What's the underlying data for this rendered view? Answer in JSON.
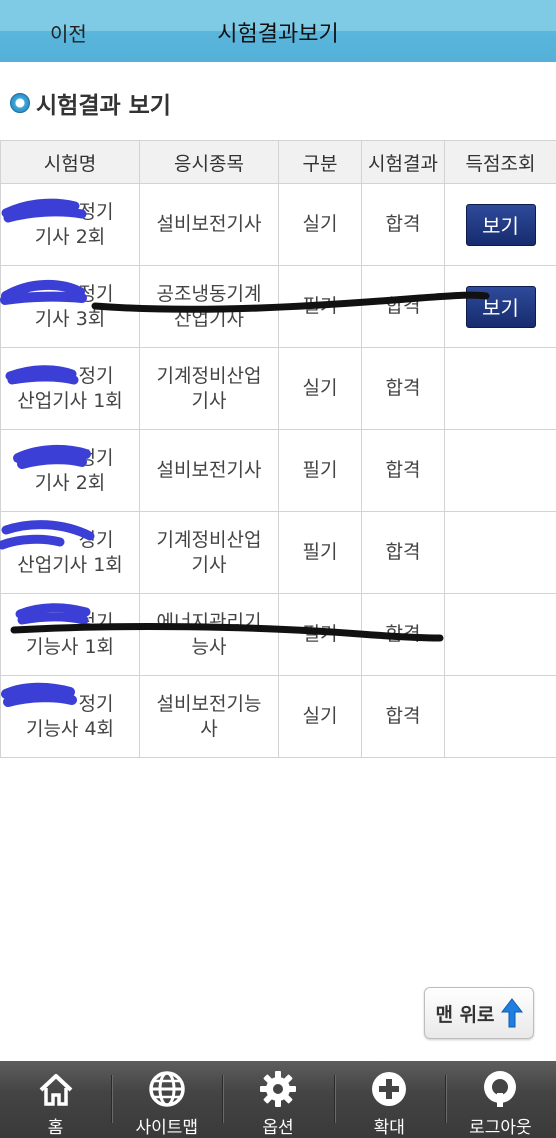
{
  "header": {
    "back_label": "이전",
    "title": "시험결과보기"
  },
  "section": {
    "title": "시험결과 보기"
  },
  "table": {
    "headers": [
      "시험명",
      "응시종목",
      "구분",
      "시험결과",
      "득점조회"
    ],
    "rows": [
      {
        "name1": "정기",
        "name2": "기사 2회",
        "subject1": "설비보전기사",
        "subject2": "",
        "type": "실기",
        "result": "합격",
        "score_button": "보기"
      },
      {
        "name1": "정기",
        "name2": "기사 3회",
        "subject1": "공조냉동기계",
        "subject2": "산업기사",
        "type": "필기",
        "result": "합격",
        "score_button": "보기"
      },
      {
        "name1": "정기",
        "name2": "산업기사 1회",
        "subject1": "기계정비산업",
        "subject2": "기사",
        "type": "실기",
        "result": "합격",
        "score_button": ""
      },
      {
        "name1": "정기",
        "name2": "기사 2회",
        "subject1": "설비보전기사",
        "subject2": "",
        "type": "필기",
        "result": "합격",
        "score_button": ""
      },
      {
        "name1": "정기",
        "name2": "산업기사 1회",
        "subject1": "기계정비산업",
        "subject2": "기사",
        "type": "필기",
        "result": "합격",
        "score_button": ""
      },
      {
        "name1": "정기",
        "name2": "기능사 1회",
        "subject1": "에너지관리기",
        "subject2": "능사",
        "type": "필기",
        "result": "합격",
        "score_button": ""
      },
      {
        "name1": "정기",
        "name2": "기능사 4회",
        "subject1": "설비보전기능",
        "subject2": "사",
        "type": "실기",
        "result": "합격",
        "score_button": ""
      }
    ]
  },
  "top_button": {
    "label": "맨 위로"
  },
  "bottom_nav": {
    "items": [
      {
        "label": "홈",
        "icon": "home-icon"
      },
      {
        "label": "사이트맵",
        "icon": "globe-icon"
      },
      {
        "label": "옵션",
        "icon": "gear-icon"
      },
      {
        "label": "확대",
        "icon": "plus-icon"
      },
      {
        "label": "로그아웃",
        "icon": "power-icon"
      }
    ]
  },
  "colors": {
    "header": "#5bb6dc",
    "button": "#1f357f",
    "nav": "#444444",
    "scribble_blue": "#3b3fd6",
    "scribble_black": "#111111"
  }
}
